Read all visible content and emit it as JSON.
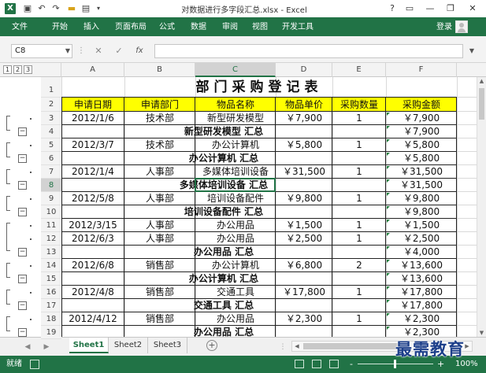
{
  "titlebar": {
    "logo": "X",
    "undo": "↶",
    "redo": "↷",
    "title": "对数据进行多字段汇总.xlsx - Excel",
    "help": "?",
    "minimize": "—",
    "restore": "❐",
    "close": "✕"
  },
  "ribbon": {
    "file": "文件",
    "tabs": [
      "开始",
      "插入",
      "页面布局",
      "公式",
      "数据",
      "审阅",
      "视图",
      "开发工具"
    ],
    "login": "登录"
  },
  "formula_bar": {
    "name_box": "C8",
    "cancel": "✕",
    "confirm": "✓",
    "fx": "fx",
    "content": ""
  },
  "outline_levels": [
    "1",
    "2",
    "3"
  ],
  "columns": [
    "A",
    "B",
    "C",
    "D",
    "E",
    "F"
  ],
  "selected_column": "C",
  "selected_row": 8,
  "sheet": {
    "title": "部门采购登记表",
    "headers": [
      "申请日期",
      "申请部门",
      "物品名称",
      "物品单价",
      "采购数量",
      "采购金额"
    ],
    "rows": [
      {
        "row": 3,
        "type": "data",
        "cells": [
          "2012/1/6",
          "技术部",
          "新型研发模型",
          "￥7,900",
          "1",
          "￥7,900"
        ]
      },
      {
        "row": 4,
        "type": "subtotal",
        "label": "新型研发模型 汇总",
        "amount": "￥7,900"
      },
      {
        "row": 5,
        "type": "data",
        "cells": [
          "2012/3/7",
          "技术部",
          "办公计算机",
          "￥5,800",
          "1",
          "￥5,800"
        ]
      },
      {
        "row": 6,
        "type": "subtotal",
        "label": "办公计算机 汇总",
        "amount": "￥5,800"
      },
      {
        "row": 7,
        "type": "data",
        "cells": [
          "2012/1/4",
          "人事部",
          "多媒体培训设备",
          "￥31,500",
          "1",
          "￥31,500"
        ]
      },
      {
        "row": 8,
        "type": "subtotal",
        "label": "多媒体培训设备 汇总",
        "amount": "￥31,500"
      },
      {
        "row": 9,
        "type": "data",
        "cells": [
          "2012/5/8",
          "人事部",
          "培训设备配件",
          "￥9,800",
          "1",
          "￥9,800"
        ]
      },
      {
        "row": 10,
        "type": "subtotal",
        "label": "培训设备配件 汇总",
        "amount": "￥9,800"
      },
      {
        "row": 11,
        "type": "data",
        "cells": [
          "2012/3/15",
          "人事部",
          "办公用品",
          "￥1,500",
          "1",
          "￥1,500"
        ]
      },
      {
        "row": 12,
        "type": "data",
        "cells": [
          "2012/6/3",
          "人事部",
          "办公用品",
          "￥2,500",
          "1",
          "￥2,500"
        ]
      },
      {
        "row": 13,
        "type": "subtotal",
        "label": "办公用品 汇总",
        "amount": "￥4,000"
      },
      {
        "row": 14,
        "type": "data",
        "cells": [
          "2012/6/8",
          "销售部",
          "办公计算机",
          "￥6,800",
          "2",
          "￥13,600"
        ]
      },
      {
        "row": 15,
        "type": "subtotal",
        "label": "办公计算机 汇总",
        "amount": "￥13,600"
      },
      {
        "row": 16,
        "type": "data",
        "cells": [
          "2012/4/8",
          "销售部",
          "交通工具",
          "￥17,800",
          "1",
          "￥17,800"
        ]
      },
      {
        "row": 17,
        "type": "subtotal",
        "label": "交通工具 汇总",
        "amount": "￥17,800"
      },
      {
        "row": 18,
        "type": "data",
        "cells": [
          "2012/4/12",
          "销售部",
          "办公用品",
          "￥2,300",
          "1",
          "￥2,300"
        ]
      },
      {
        "row": 19,
        "type": "subtotal",
        "label": "办公用品 汇总",
        "amount": "￥2,300"
      }
    ]
  },
  "sheet_tabs": [
    "Sheet1",
    "Sheet2",
    "Sheet3"
  ],
  "active_sheet": "Sheet1",
  "add_sheet": "+",
  "status": {
    "ready": "就绪",
    "zoom_minus": "-",
    "zoom_plus": "+",
    "zoom": "100%",
    "zoom_level": 1.0
  },
  "watermark": "最需教育",
  "colors": {
    "excel_green": "#217346",
    "header_fill": "#ffff00"
  }
}
